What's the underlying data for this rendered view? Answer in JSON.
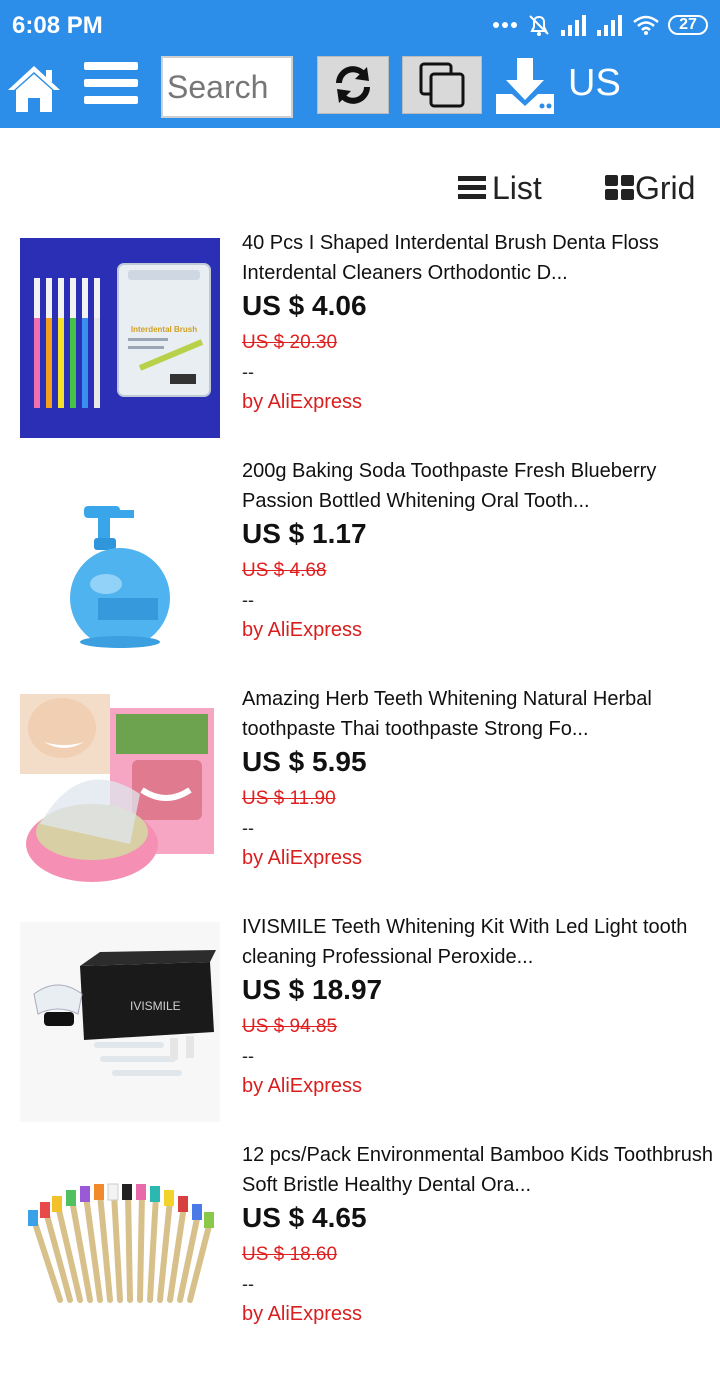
{
  "status": {
    "time": "6:08 PM",
    "battery": "27"
  },
  "toolbar": {
    "search_placeholder": "Search",
    "region": "US"
  },
  "view": {
    "list_label": "List",
    "grid_label": "Grid"
  },
  "products": [
    {
      "title": "40 Pcs I Shaped Interdental Brush Denta Floss Interdental Cleaners Orthodontic D...",
      "price": "US $ 4.06",
      "old_price": "US $ 20.30",
      "extra": "--",
      "source": "by AliExpress",
      "thumb_label": "Interdental Brush"
    },
    {
      "title": "200g Baking Soda Toothpaste Fresh Blueberry Passion Bottled Whitening Oral Tooth...",
      "price": "US $ 1.17",
      "old_price": "US $ 4.68",
      "extra": "--",
      "source": "by AliExpress"
    },
    {
      "title": "Amazing Herb Teeth Whitening Natural Herbal toothpaste Thai toothpaste Strong Fo...",
      "price": "US $ 5.95",
      "old_price": "US $ 11.90",
      "extra": "--",
      "source": "by AliExpress"
    },
    {
      "title": "IVISMILE Teeth Whitening Kit With Led Light tooth cleaning Professional Peroxide...",
      "price": "US $ 18.97",
      "old_price": "US $ 94.85",
      "extra": "--",
      "source": "by AliExpress",
      "thumb_label": "IVISMILE"
    },
    {
      "title": "12 pcs/Pack Environmental Bamboo Kids Toothbrush Soft Bristle Healthy Dental Ora...",
      "price": "US $ 4.65",
      "old_price": "US $ 18.60",
      "extra": "--",
      "source": "by AliExpress"
    }
  ],
  "colors": {
    "header_blue": "#2c8ee8",
    "old_price_red": "#e02020",
    "source_red": "#d81e1e"
  }
}
